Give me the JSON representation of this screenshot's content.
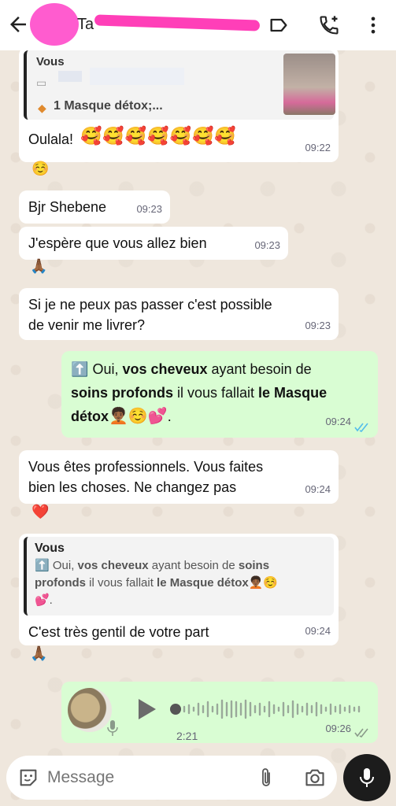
{
  "header": {
    "contact_name": "Ta",
    "icons": [
      "arrow-left-icon",
      "label-icon",
      "add-call-icon",
      "more-vert-icon"
    ]
  },
  "messages": {
    "quote1": {
      "author": "Vous",
      "preview": "1 Masque détox;..."
    },
    "m1": {
      "text": "Oulala!",
      "emojis": "🥰🥰🥰🥰🥰🥰🥰",
      "time": "09:22",
      "reaction": "☺️"
    },
    "m2": {
      "text": "Bjr Shebene",
      "time": "09:23"
    },
    "m3": {
      "text": "J'espère que vous allez bien",
      "time": "09:23",
      "reaction": "🙏🏾"
    },
    "m4": {
      "text_line1": "Si je ne peux pas passer c'est possible",
      "text_line2": "de venir me livrer?",
      "time": "09:23"
    },
    "m5": {
      "emoji_up": "⬆️",
      "t1": "Oui, ",
      "b1": "vos cheveux",
      "t2": " ayant besoin de",
      "b2": "soins profonds",
      "t3": " il vous fallait ",
      "b3": "le Masque",
      "b4": "détox",
      "emojis": "🧑🏾‍🦱☺️💕",
      "t4": ".",
      "time": "09:24",
      "status": "read"
    },
    "m6": {
      "text_line1": "Vous êtes professionnels. Vous faites",
      "text_line2": "bien les choses.  Ne changez pas",
      "time": "09:24",
      "reaction": "❤️"
    },
    "m7": {
      "quote_author": "Vous",
      "quote_t1": "Oui, ",
      "quote_b1": "vos cheveux",
      "quote_t2": " ayant besoin de ",
      "quote_b2": "soins",
      "quote_b3": "profonds",
      "quote_t3": " il vous fallait ",
      "quote_b4": "le Masque détox",
      "quote_emojis": "🧑🏾‍🦱☺️",
      "quote_end": "💕.",
      "text": "C'est très gentil de votre part",
      "time": "09:24",
      "reaction": "🙏🏾"
    },
    "voice": {
      "duration": "2:21",
      "time": "09:26"
    }
  },
  "input": {
    "placeholder": "Message"
  },
  "colors": {
    "incoming": "#ffffff",
    "outgoing": "#d9fdd3",
    "read_tick": "#53bdeb",
    "redaction": "#ff3fb8"
  }
}
